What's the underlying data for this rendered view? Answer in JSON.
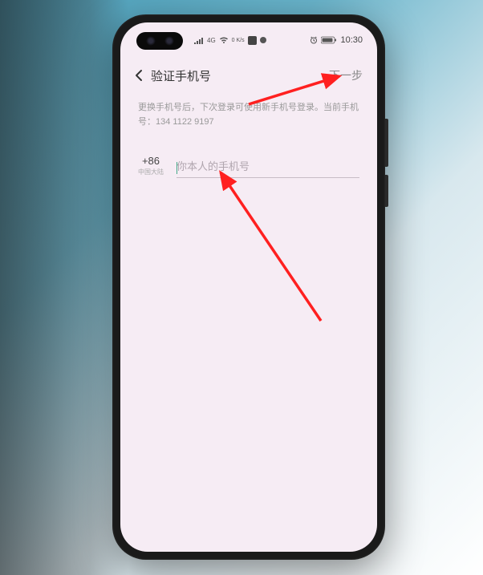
{
  "status_bar": {
    "network_label": "4G",
    "speed_label": "0 K/s",
    "time": "10:30"
  },
  "header": {
    "title": "验证手机号",
    "next_label": "下一步"
  },
  "description": {
    "line1": "更换手机号后，下次登录可使用新手机号登录。当前手机",
    "line2": "号：134 1122 9197"
  },
  "phone_input": {
    "country_code": "+86",
    "country_label": "中国大陆",
    "placeholder": "你本人的手机号"
  }
}
